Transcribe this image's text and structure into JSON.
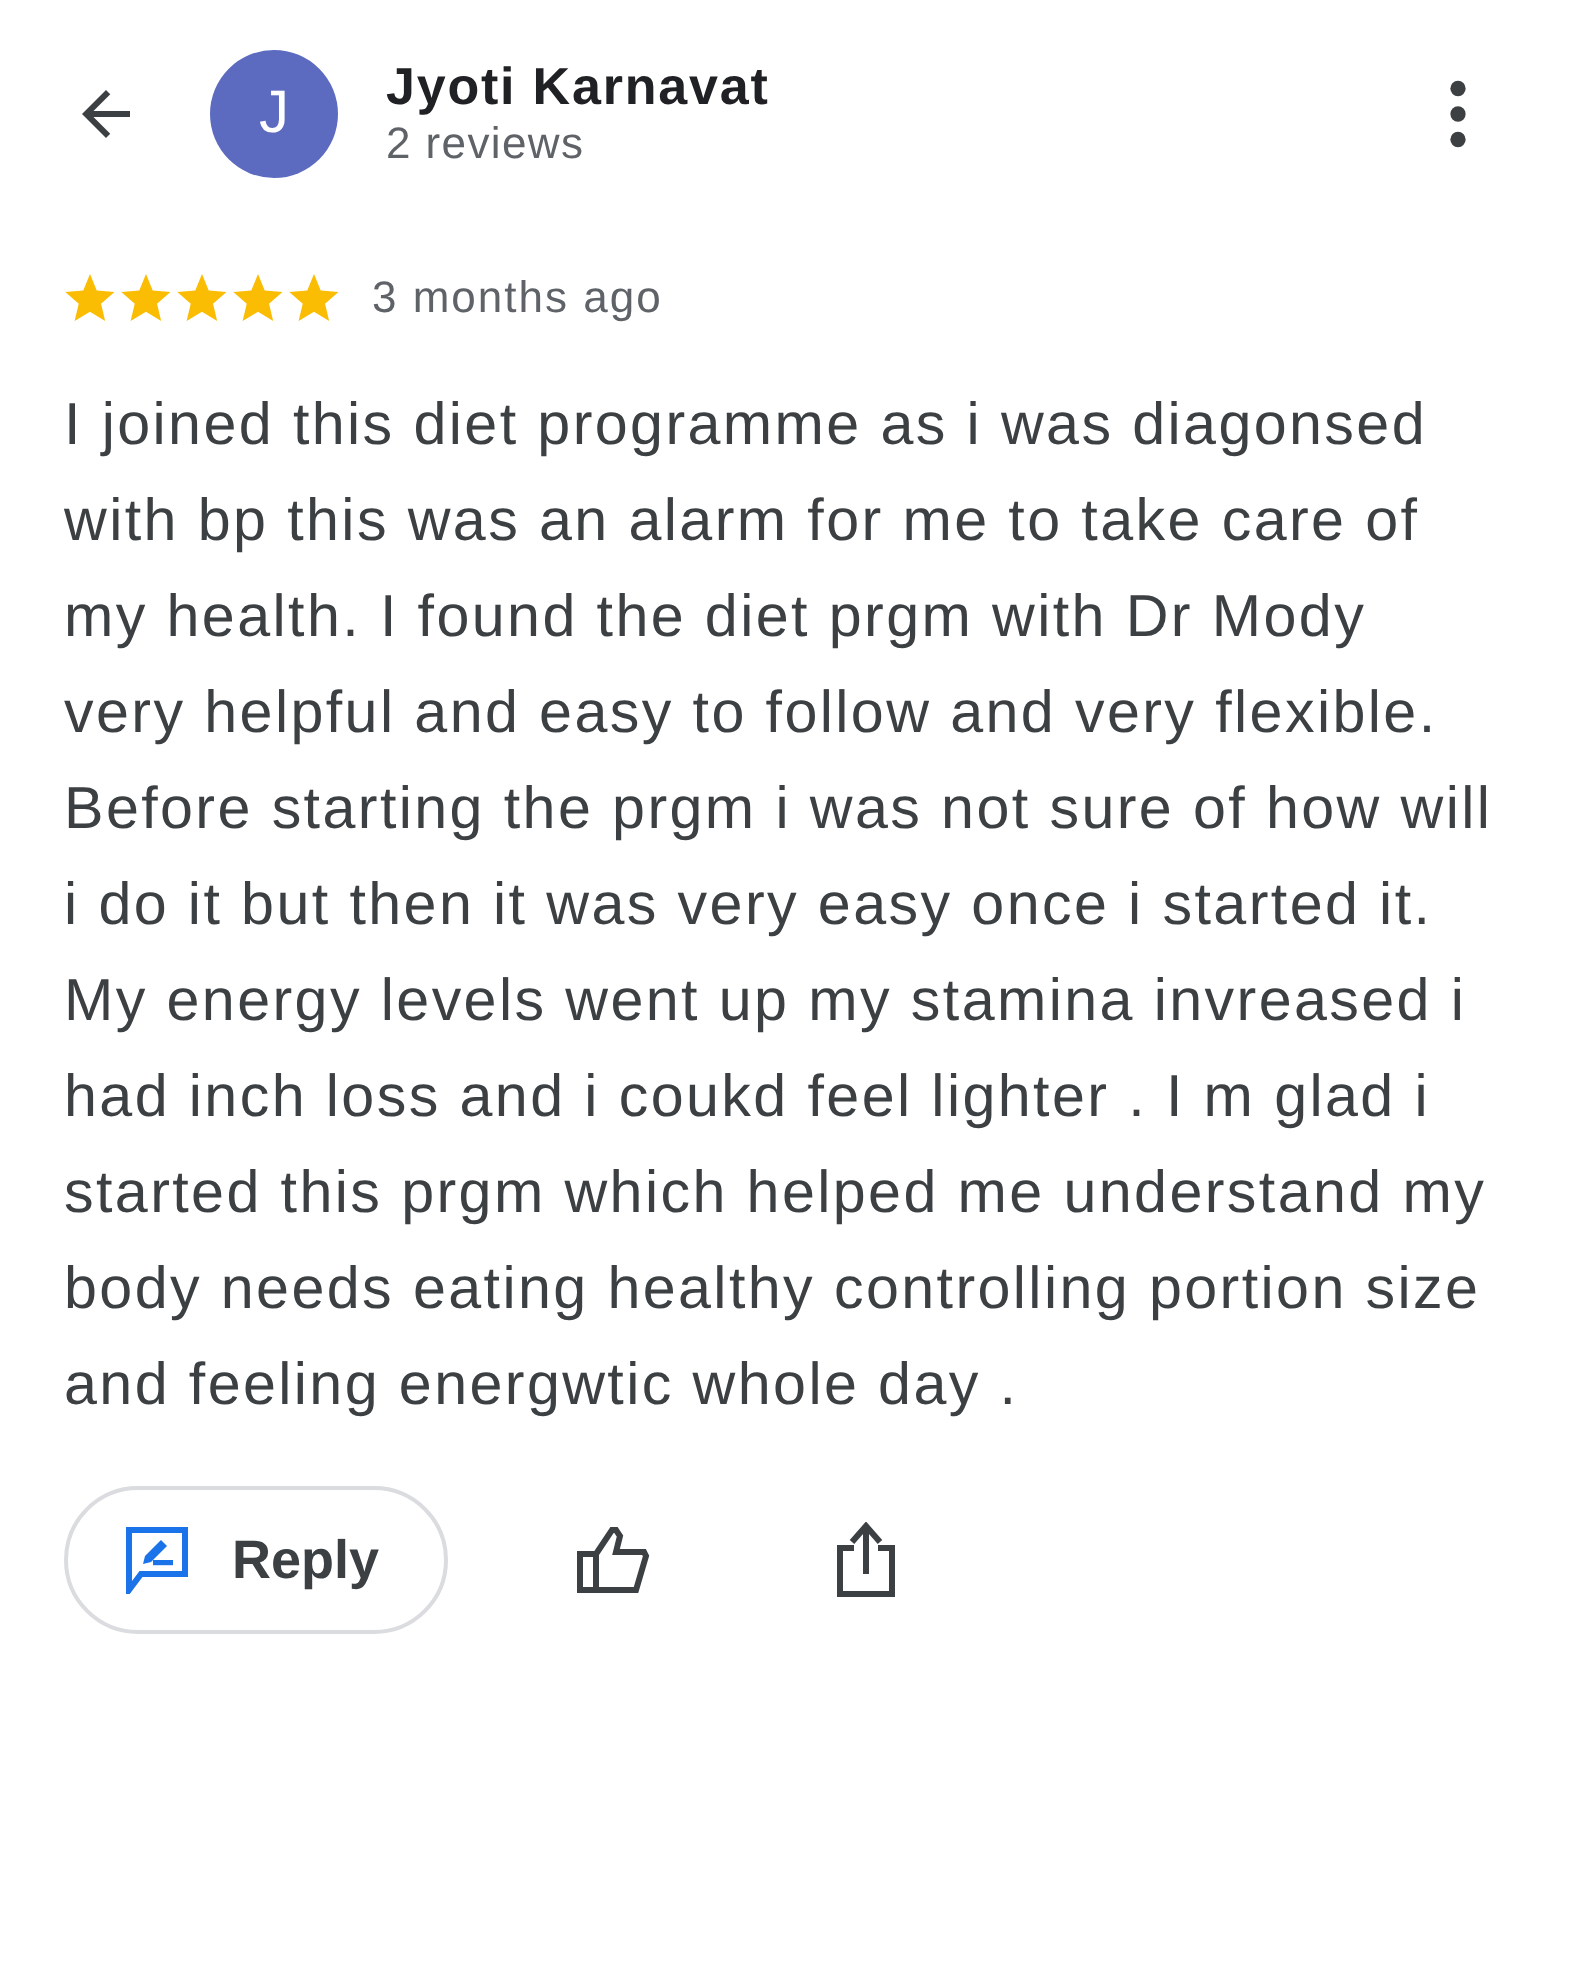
{
  "header": {
    "avatar_letter": "J",
    "name": "Jyoti Karnavat",
    "subtitle": "2 reviews"
  },
  "review": {
    "stars": 5,
    "time": "3 months ago",
    "text": "I joined this diet programme as i was diagonsed with bp this was an alarm for me to take care of my health. I found the diet prgm with Dr Mody very helpful and easy to follow and very flexible. Before starting the prgm i was not sure of how will i do it but then it was very easy once i started it. My energy levels went up my stamina invreased i had inch loss and i coukd feel lighter . I m glad i started this prgm which helped me understand my body needs eating healthy controlling portion size and feeling energwtic whole day ."
  },
  "actions": {
    "reply_label": "Reply"
  }
}
